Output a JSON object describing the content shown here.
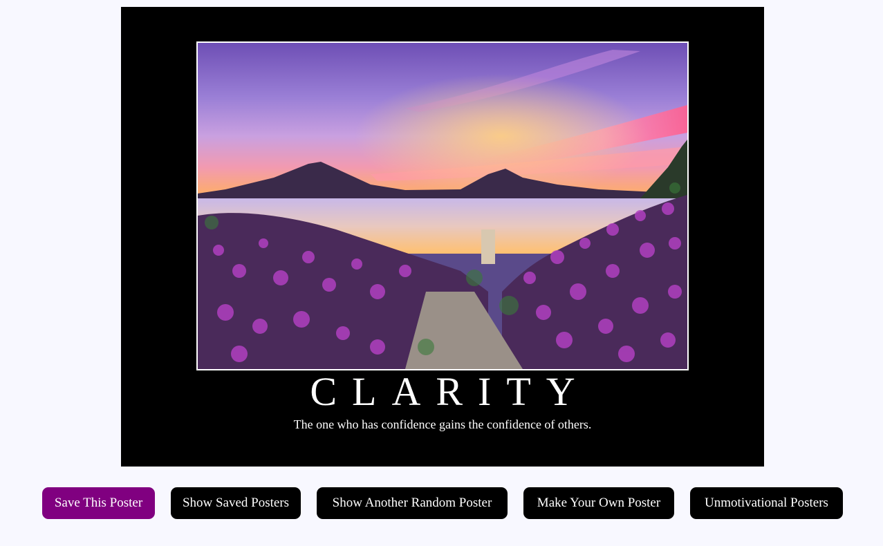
{
  "poster": {
    "title": "CLARITY",
    "quote": "The one who has confidence gains the confidence of others."
  },
  "buttons": {
    "save": "Save This Poster",
    "show_saved": "Show Saved Posters",
    "random": "Show Another Random Poster",
    "make_own": "Make Your Own Poster",
    "unmotivational": "Unmotivational Posters"
  },
  "colors": {
    "page_background": "#f8f8ff",
    "poster_background": "#000000",
    "save_button": "#800080",
    "button": "#000000",
    "button_text": "#ffffff"
  }
}
